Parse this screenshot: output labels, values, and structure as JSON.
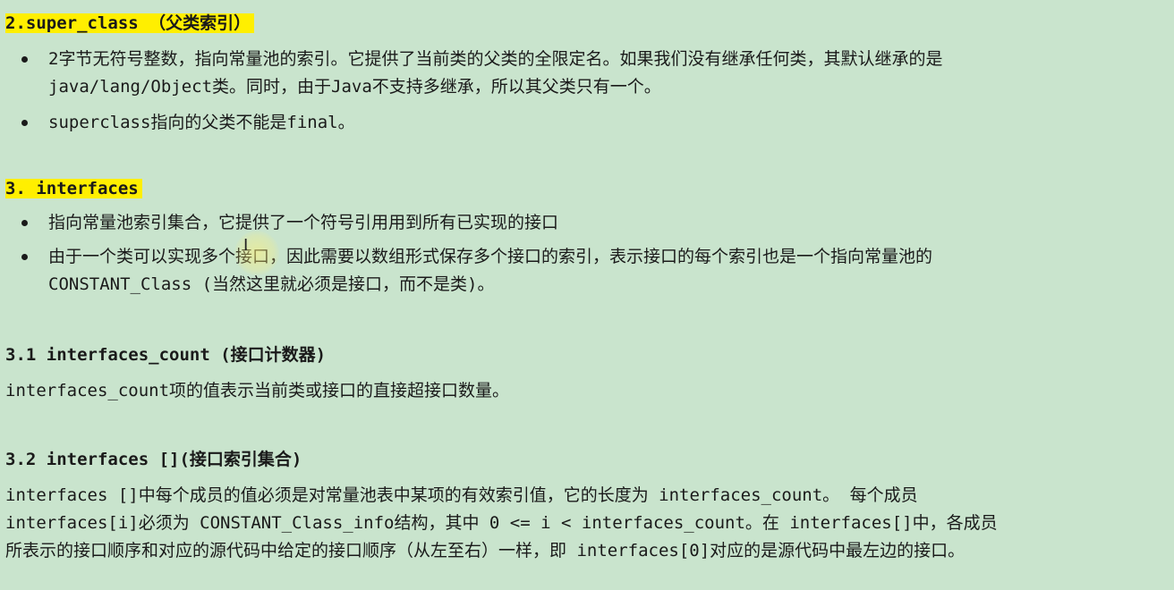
{
  "section2": {
    "heading": "2.super_class （父类索引）",
    "bullets": [
      {
        "line1": "2字节无符号整数，指向常量池的索引。它提供了当前类的父类的全限定名。如果我们没有继承任何类，其默认继承的是",
        "line2": "java/lang/Object类。同时，由于Java不支持多继承，所以其父类只有一个。"
      },
      {
        "line1": "superclass指向的父类不能是final。"
      }
    ]
  },
  "section3": {
    "heading": "3. interfaces",
    "bullets": [
      {
        "line1": "指向常量池索引集合，它提供了一个符号引用用到所有已实现的接口"
      },
      {
        "line1": "由于一个类可以实现多个接口，因此需要以数组形式保存多个接口的索引，表示接口的每个索引也是一个指向常量池的",
        "line2": "CONSTANT_Class (当然这里就必须是接口，而不是类)。"
      }
    ]
  },
  "section31": {
    "heading": "3.1 interfaces_count (接口计数器)",
    "text": "interfaces_count项的值表示当前类或接口的直接超接口数量。"
  },
  "section32": {
    "heading": "3.2 interfaces [](接口索引集合)",
    "lines": [
      "interfaces []中每个成员的值必须是对常量池表中某项的有效索引值，它的长度为 interfaces_count。 每个成员",
      "interfaces[i]必须为 CONSTANT_Class_info结构，其中 0 <= i < interfaces_count。在 interfaces[]中，各成员",
      "所表示的接口顺序和对应的源代码中给定的接口顺序（从左至右）一样，即 interfaces[0]对应的是源代码中最左边的接口。"
    ]
  },
  "colors": {
    "background": "#c9e4cd",
    "highlight": "#ffef00",
    "text": "#1a1a1a"
  },
  "icons": {
    "cursor": "text-cursor-icon"
  }
}
